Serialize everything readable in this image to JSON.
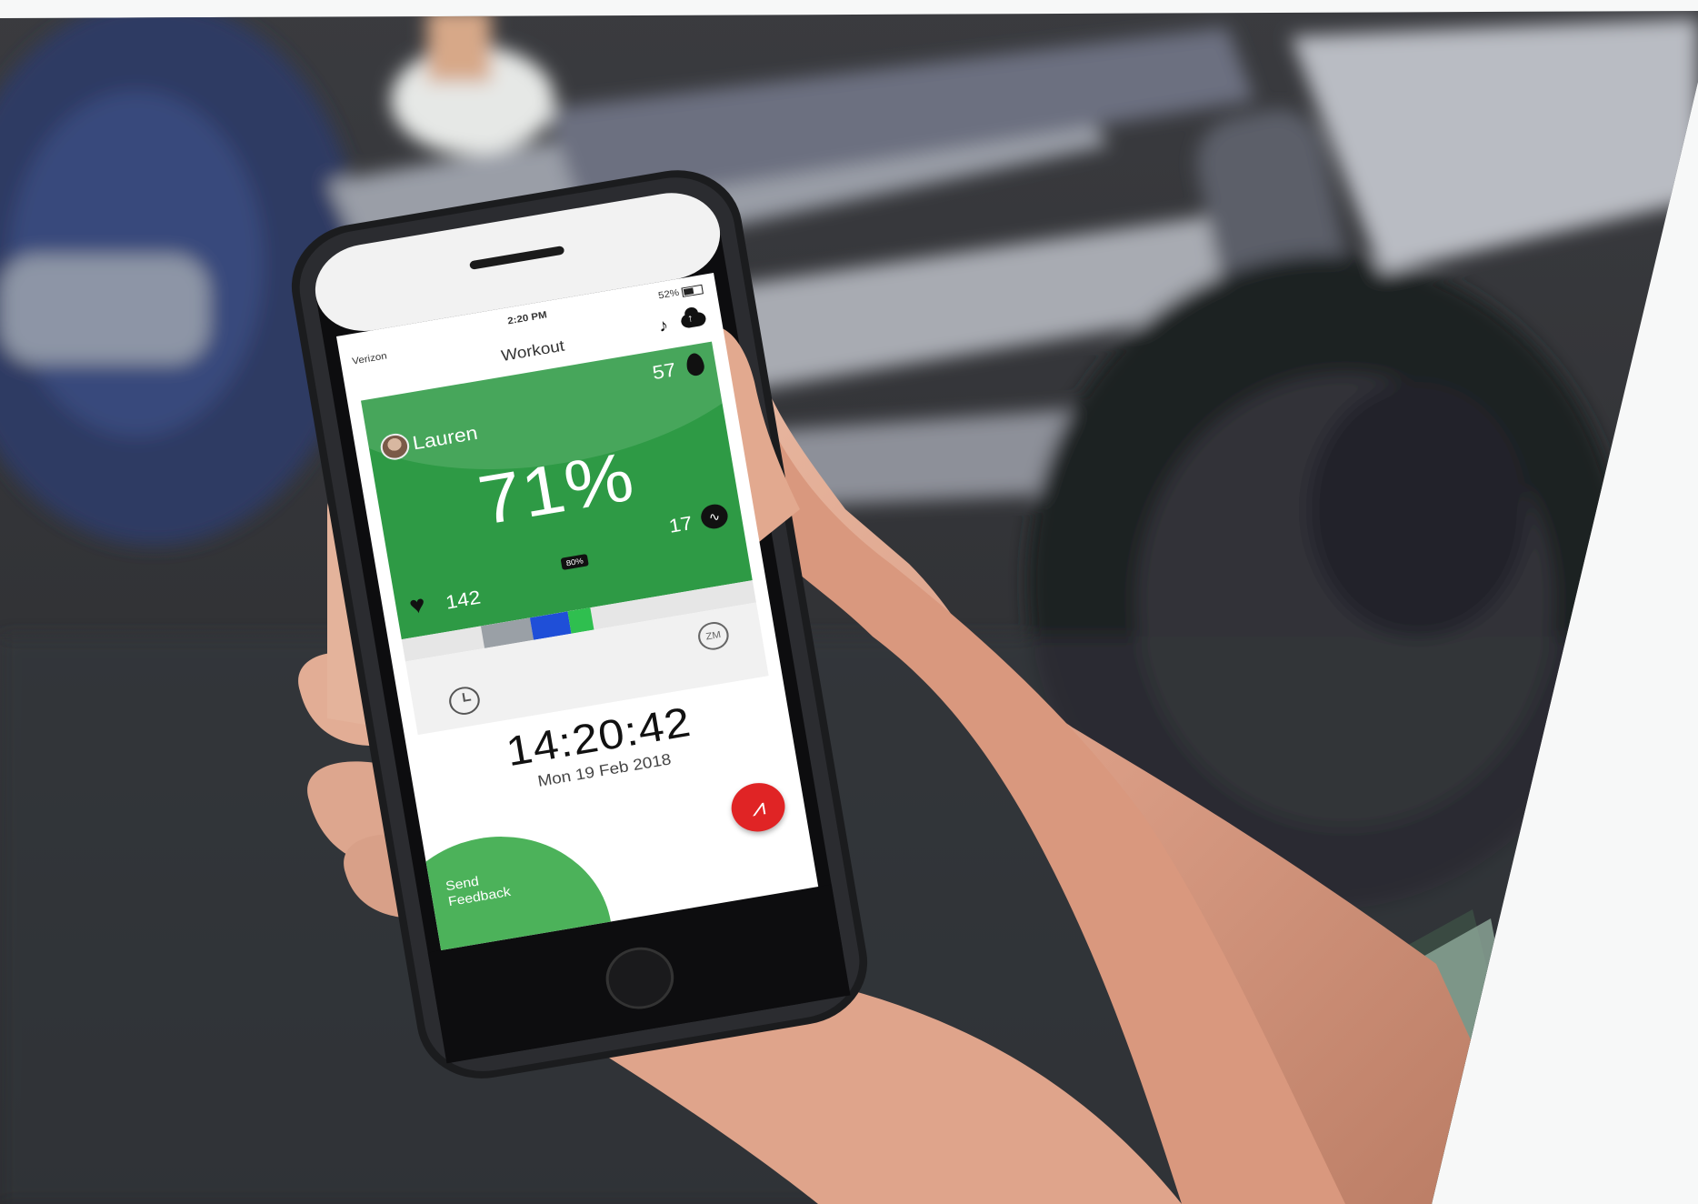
{
  "status": {
    "carrier": "Verizon",
    "time": "2:20 PM",
    "battery": "52%"
  },
  "nav": {
    "title": "Workout"
  },
  "icons": {
    "music": "music-note-icon",
    "cloud": "cloud-upload-icon",
    "flame": "flame-icon",
    "heart": "heart-icon",
    "zone": "heartbeat-zone-icon",
    "clock": "clock-icon",
    "zm": "zm-icon",
    "record": "heartbeat-logo-icon"
  },
  "workout": {
    "user_name": "Lauren",
    "calories": "57",
    "effort_percent": "71%",
    "points": "17",
    "heart_rate": "142",
    "zone_badge": "80%",
    "zm_label": "ZM",
    "record_glyph": "⩘"
  },
  "clock": {
    "time": "14:20:42",
    "date": "Mon 19 Feb 2018"
  },
  "feedback": {
    "label": "Send Feedback"
  },
  "colors": {
    "card_green": "#2e9a45",
    "feedback_green": "#4cb25a",
    "record_red": "#e02425",
    "zone_blue": "#1f4fd8",
    "zone_grey": "#9aa0a6",
    "page_background": "#f7f8f8"
  }
}
